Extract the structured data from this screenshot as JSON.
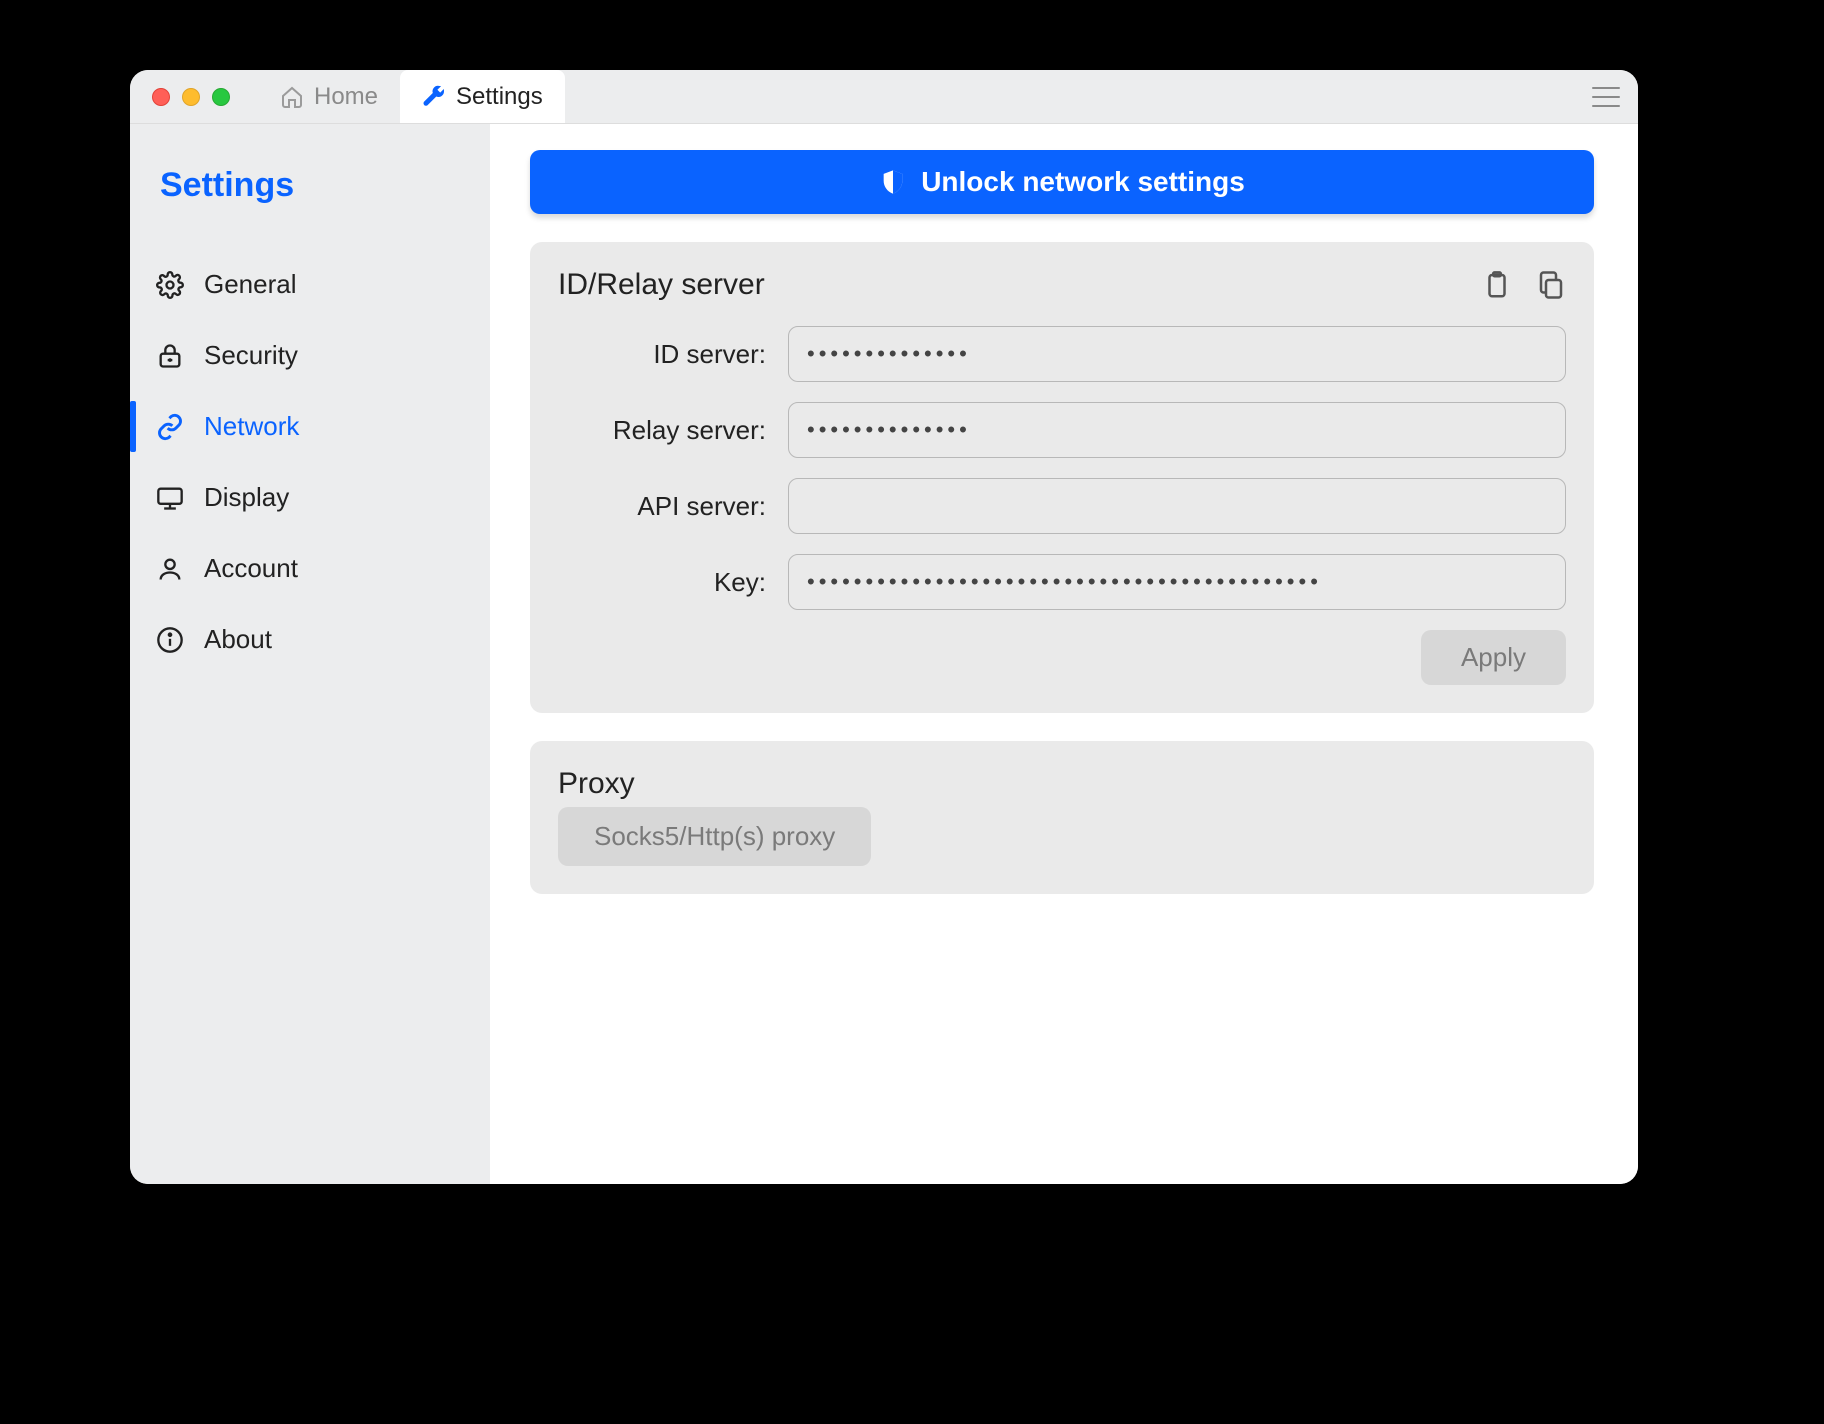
{
  "tabs": {
    "home": "Home",
    "settings": "Settings"
  },
  "sidebar": {
    "title": "Settings",
    "items": [
      {
        "label": "General"
      },
      {
        "label": "Security"
      },
      {
        "label": "Network"
      },
      {
        "label": "Display"
      },
      {
        "label": "Account"
      },
      {
        "label": "About"
      }
    ]
  },
  "unlock": {
    "label": "Unlock network settings"
  },
  "relay_panel": {
    "title": "ID/Relay server",
    "fields": {
      "id_server": {
        "label": "ID server:",
        "value": "••••••••••••••"
      },
      "relay_server": {
        "label": "Relay server:",
        "value": "••••••••••••••"
      },
      "api_server": {
        "label": "API server:",
        "value": ""
      },
      "key": {
        "label": "Key:",
        "value": "••••••••••••••••••••••••••••••••••••••••••••"
      }
    },
    "apply": "Apply"
  },
  "proxy_panel": {
    "title": "Proxy",
    "button": "Socks5/Http(s) proxy"
  }
}
